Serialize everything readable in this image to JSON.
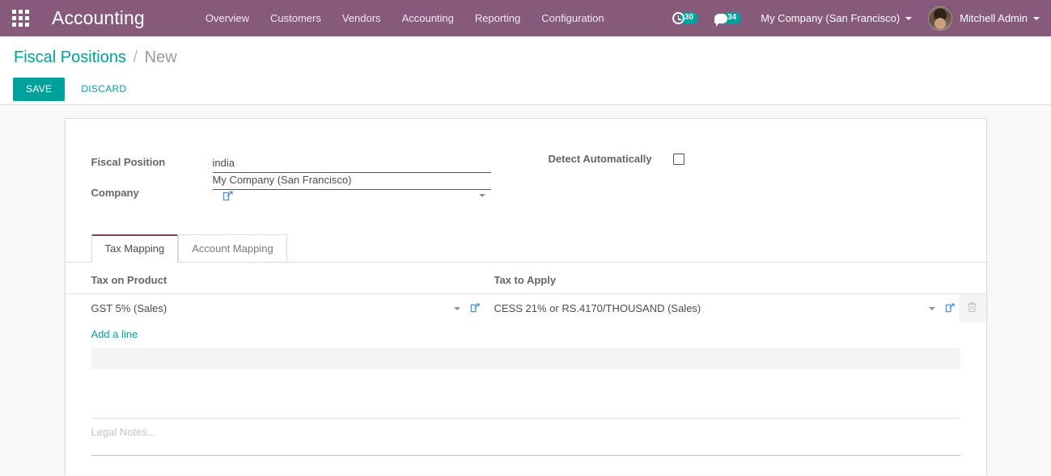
{
  "navbar": {
    "apps_icon": "grid-apps-icon",
    "brand": "Accounting",
    "menu": [
      {
        "label": "Overview"
      },
      {
        "label": "Customers"
      },
      {
        "label": "Vendors"
      },
      {
        "label": "Accounting"
      },
      {
        "label": "Reporting"
      },
      {
        "label": "Configuration"
      }
    ],
    "activity": {
      "icon": "clock-icon",
      "count": "30"
    },
    "messages": {
      "icon": "speech-bubble-icon",
      "count": "34"
    },
    "company_switcher": "My Company (San Francisco)",
    "user": "Mitchell Admin",
    "accent_color": "#875a7b",
    "badge_color": "#00a09d"
  },
  "control_panel": {
    "breadcrumb": {
      "root": "Fiscal Positions",
      "separator": "/",
      "current": "New"
    },
    "save_label": "SAVE",
    "discard_label": "DISCARD",
    "save_color": "#00a09d"
  },
  "form": {
    "fields": {
      "fiscal_position": {
        "label": "Fiscal Position",
        "value": "india",
        "placeholder": ""
      },
      "company": {
        "label": "Company",
        "value": "My Company (San Francisco)",
        "placeholder": "",
        "external_link_icon": "external-link-icon"
      },
      "detect_automatically": {
        "label": "Detect Automatically",
        "checked": false
      }
    }
  },
  "notebook": {
    "tabs": [
      {
        "label": "Tax Mapping",
        "active": true
      },
      {
        "label": "Account Mapping",
        "active": false
      }
    ]
  },
  "tax_mapping": {
    "columns": [
      "Tax on Product",
      "Tax to Apply"
    ],
    "rows": [
      {
        "tax_on_product": "GST 5% (Sales)",
        "tax_to_apply": "CESS 21% or RS.4170/THOUSAND (Sales)",
        "delete_icon": "trash-icon"
      }
    ],
    "add_line_label": "Add a line"
  },
  "notes": {
    "placeholder": "Legal Notes..."
  }
}
